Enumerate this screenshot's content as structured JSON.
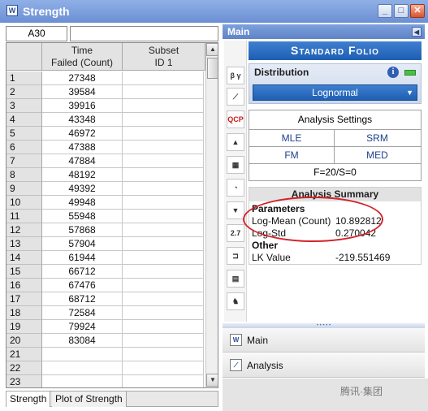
{
  "window": {
    "title": "Strength",
    "app_icon": "W",
    "min": "_",
    "max": "□",
    "close": "✕"
  },
  "cell_ref": "A30",
  "columns": [
    {
      "line1": "Time",
      "line2": "Failed (Count)"
    },
    {
      "line1": "Subset",
      "line2": "ID 1"
    }
  ],
  "rows": [
    {
      "n": "1",
      "v": "27348"
    },
    {
      "n": "2",
      "v": "39584"
    },
    {
      "n": "3",
      "v": "39916"
    },
    {
      "n": "4",
      "v": "43348"
    },
    {
      "n": "5",
      "v": "46972"
    },
    {
      "n": "6",
      "v": "47388"
    },
    {
      "n": "7",
      "v": "47884"
    },
    {
      "n": "8",
      "v": "48192"
    },
    {
      "n": "9",
      "v": "49392"
    },
    {
      "n": "10",
      "v": "49948"
    },
    {
      "n": "11",
      "v": "55948"
    },
    {
      "n": "12",
      "v": "57868"
    },
    {
      "n": "13",
      "v": "57904"
    },
    {
      "n": "14",
      "v": "61944"
    },
    {
      "n": "15",
      "v": "66712"
    },
    {
      "n": "16",
      "v": "67476"
    },
    {
      "n": "17",
      "v": "68712"
    },
    {
      "n": "18",
      "v": "72584"
    },
    {
      "n": "19",
      "v": "79924"
    },
    {
      "n": "20",
      "v": "83084"
    },
    {
      "n": "21",
      "v": ""
    },
    {
      "n": "22",
      "v": ""
    },
    {
      "n": "23",
      "v": ""
    }
  ],
  "sheet_tabs": [
    "Strength",
    "Plot of Strength"
  ],
  "panel": {
    "header": "Main",
    "folio_title": "Standard Folio",
    "distribution_label": "Distribution",
    "distribution_value": "Lognormal",
    "analysis_settings": "Analysis Settings",
    "mle": "MLE",
    "srm": "SRM",
    "fm": "FM",
    "med": "MED",
    "fs": "F=20/S=0",
    "summary_title": "Analysis Summary",
    "parameters_label": "Parameters",
    "log_mean_label": "Log-Mean (Count)",
    "log_mean_value": "10.892812",
    "log_std_label": "Log-Std",
    "log_std_value": "0.270042",
    "other_label": "Other",
    "lk_label": "LK Value",
    "lk_value": "-219.551469"
  },
  "nav": {
    "main": "Main",
    "analysis": "Analysis"
  },
  "watermark": "腾讯·集团",
  "colors": {
    "accent": "#1e5fb3",
    "highlight": "#d2232a"
  },
  "icons": [
    "beta-icon",
    "probability-plot-icon",
    "qcp-icon",
    "hazard-icon",
    "grid-icon",
    "gauge-icon",
    "funnel-icon",
    "parameter-icon",
    "report-icon",
    "table-icon",
    "runner-icon"
  ]
}
